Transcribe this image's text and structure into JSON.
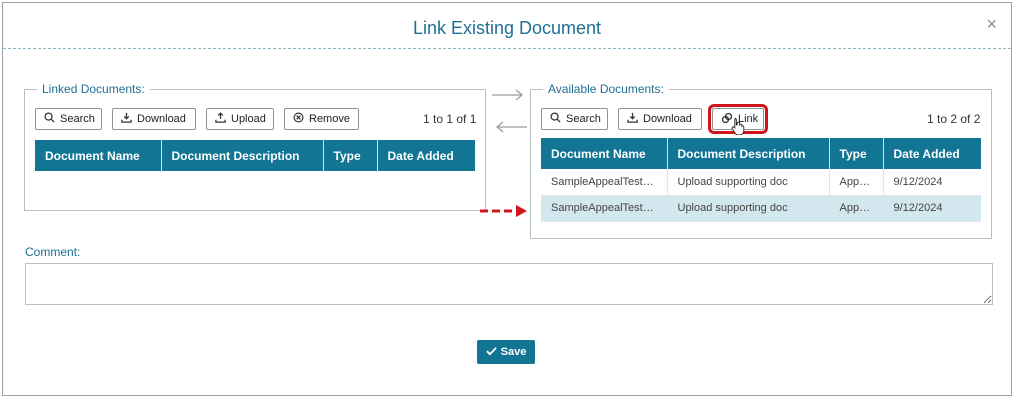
{
  "dialog": {
    "title": "Link Existing Document",
    "close_icon": "×"
  },
  "linked": {
    "legend": "Linked Documents:",
    "buttons": {
      "search": "Search",
      "download": "Download",
      "upload": "Upload",
      "remove": "Remove"
    },
    "count": "1 to 1 of 1",
    "columns": [
      "Document Name",
      "Document Description",
      "Type",
      "Date Added"
    ],
    "rows": []
  },
  "available": {
    "legend": "Available Documents:",
    "buttons": {
      "search": "Search",
      "download": "Download",
      "link": "Link"
    },
    "count": "1 to 2 of 2",
    "columns": [
      "Document Name",
      "Document Description",
      "Type",
      "Date Added"
    ],
    "rows": [
      [
        "SampleAppealTest…",
        "Upload supporting doc",
        "App…",
        "9/12/2024"
      ],
      [
        "SampleAppealTest…",
        "Upload supporting doc",
        "App…",
        "9/12/2024"
      ]
    ]
  },
  "comment": {
    "label": "Comment:",
    "value": ""
  },
  "save_label": "Save",
  "colors": {
    "accent": "#117593",
    "title": "#1f6f94",
    "highlight": "#d0141c",
    "selected_row": "#d3e7ee"
  },
  "icons": {
    "search": "search-icon",
    "download": "download-icon",
    "upload": "upload-icon",
    "remove": "remove-circle-icon",
    "link": "link-icon",
    "save": "check-icon"
  }
}
